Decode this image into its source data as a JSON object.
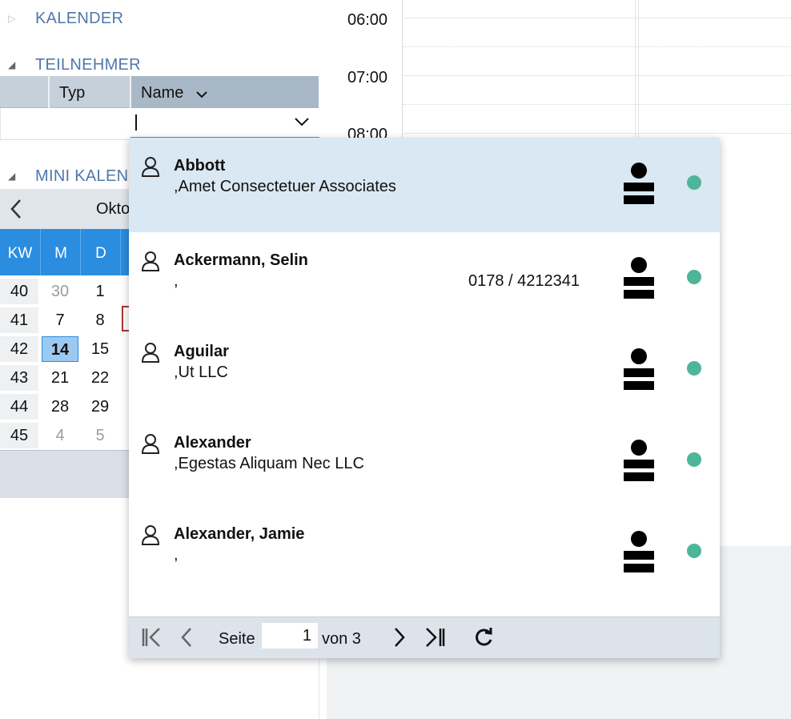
{
  "sidebar": {
    "sections": [
      {
        "label": "KALENDER",
        "expanded": false
      },
      {
        "label": "TEILNEHMER",
        "expanded": true
      },
      {
        "label": "MINI KALEN",
        "expanded": true
      }
    ]
  },
  "participants_grid": {
    "columns": [
      "Typ",
      "Name"
    ],
    "filter_value": ""
  },
  "mini_calendar": {
    "month_label": "Okto",
    "headers": [
      "KW",
      "M",
      "D"
    ],
    "rows": [
      {
        "kw": "40",
        "d1": "30",
        "d2": "1",
        "d1_muted": true,
        "d2_muted": false
      },
      {
        "kw": "41",
        "d1": "7",
        "d2": "8",
        "d1_muted": false,
        "d2_muted": false
      },
      {
        "kw": "42",
        "d1": "14",
        "d2": "15",
        "d1_muted": false,
        "d2_muted": false,
        "today": "d1"
      },
      {
        "kw": "43",
        "d1": "21",
        "d2": "22",
        "d1_muted": false,
        "d2_muted": false
      },
      {
        "kw": "44",
        "d1": "28",
        "d2": "29",
        "d1_muted": false,
        "d2_muted": false
      },
      {
        "kw": "45",
        "d1": "4",
        "d2": "5",
        "d1_muted": true,
        "d2_muted": true
      }
    ]
  },
  "day_view": {
    "times": [
      "06:00",
      "07:00",
      "08:00"
    ]
  },
  "dropdown": {
    "items": [
      {
        "name": "Abbott",
        "sub": ",Amet Consectetuer Associates",
        "phone": "",
        "selected": true,
        "status_color": "#4db59a"
      },
      {
        "name": "Ackermann, Selin",
        "sub": ",",
        "phone": "0178 / 4212341",
        "selected": false,
        "status_color": "#4db59a"
      },
      {
        "name": "Aguilar",
        "sub": ",Ut LLC",
        "phone": "",
        "selected": false,
        "status_color": "#4db59a"
      },
      {
        "name": "Alexander",
        "sub": ",Egestas Aliquam Nec LLC",
        "phone": "",
        "selected": false,
        "status_color": "#4db59a"
      },
      {
        "name": "Alexander, Jamie",
        "sub": ",",
        "phone": "",
        "selected": false,
        "status_color": "#4db59a"
      }
    ],
    "pager": {
      "page_label": "Seite",
      "current_page": "1",
      "of_label": "von 3"
    }
  },
  "colors": {
    "accent_blue": "#2a8de0",
    "section_title": "#5077ac",
    "status_green": "#4db59a",
    "selected_row": "#d9e8f3"
  }
}
